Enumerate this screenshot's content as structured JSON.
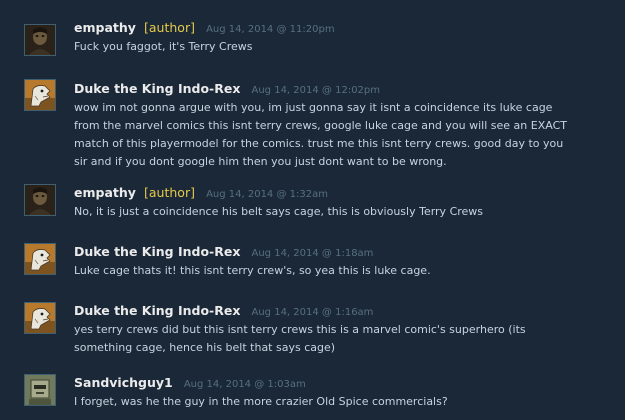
{
  "comments": [
    {
      "author": "empathy",
      "tag": "[author]",
      "timestamp": "Aug 14, 2014 @ 11:20pm",
      "text": "Fuck you faggot, it's Terry Crews",
      "avatar_icon": "dark-portrait-avatar-icon"
    },
    {
      "author": "Duke the King Indo-Rex",
      "tag": "",
      "timestamp": "Aug 14, 2014 @ 12:02pm",
      "text": "wow im not gonna argue with you, im just gonna say it isnt a coincidence its luke cage from the marvel comics this isnt terry crews, google luke cage and you will see an EXACT match of this playermodel for the comics. trust me this isnt terry crews. good day to you sir and if you dont google him then you just dont want to be wrong.",
      "avatar_icon": "dinosaur-avatar-icon"
    },
    {
      "author": "empathy",
      "tag": "[author]",
      "timestamp": "Aug 14, 2014 @ 1:32am",
      "text": "No, it is just a coincidence his belt says cage, this is obviously Terry Crews",
      "avatar_icon": "dark-portrait-avatar-icon"
    },
    {
      "author": "Duke the King Indo-Rex",
      "tag": "",
      "timestamp": "Aug 14, 2014 @ 1:18am",
      "text": "Luke cage thats it! this isnt terry crew's, so yea this is luke cage.",
      "avatar_icon": "dinosaur-avatar-icon"
    },
    {
      "author": "Duke the King Indo-Rex",
      "tag": "",
      "timestamp": "Aug 14, 2014 @ 1:16am",
      "text": "yes terry crews did but this isnt terry crews this is a marvel comic's superhero (its something cage, hence his belt that says cage)",
      "avatar_icon": "dinosaur-avatar-icon"
    },
    {
      "author": "Sandvichguy1",
      "tag": "",
      "timestamp": "Aug 14, 2014 @ 1:03am",
      "text": "I forget, was he the guy in the more crazier Old Spice commercials?",
      "avatar_icon": "robot-helmet-avatar-icon"
    }
  ],
  "colors": {
    "background": "#1b2838",
    "author_name": "#ebebeb",
    "author_tag": "#e5c94a",
    "timestamp": "#56707f",
    "comment_text": "#c6d4df"
  }
}
